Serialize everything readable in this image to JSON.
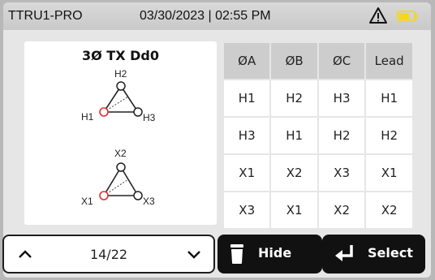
{
  "status_bar": {
    "device_name": "TTRU1-PRO",
    "datetime": "03/30/2023 | 02:55 PM",
    "warning_icon": "warning-triangle-icon",
    "battery_icon": "battery-icon",
    "battery_color": "#f5d61e"
  },
  "diagram": {
    "title": "3Ø TX Dd0",
    "top_delta": {
      "top_label": "H2",
      "left_label": "H1",
      "right_label": "H3"
    },
    "bottom_delta": {
      "top_label": "X2",
      "left_label": "X1",
      "right_label": "X3"
    },
    "highlight_color": "#e03030"
  },
  "table": {
    "headers": [
      "ØA",
      "ØB",
      "ØC",
      "Lead"
    ],
    "rows": [
      [
        "H1",
        "H2",
        "H3",
        "H1"
      ],
      [
        "H3",
        "H1",
        "H2",
        "H2"
      ],
      [
        "X1",
        "X2",
        "X3",
        "X1"
      ],
      [
        "X3",
        "X1",
        "X2",
        "X2"
      ]
    ]
  },
  "pager": {
    "text": "14/22",
    "up_icon": "chevron-up-icon",
    "down_icon": "chevron-down-icon"
  },
  "hide_button": {
    "label": "Hide",
    "icon": "trash-icon"
  },
  "select_button": {
    "label": "Select",
    "icon": "enter-arrow-icon"
  }
}
